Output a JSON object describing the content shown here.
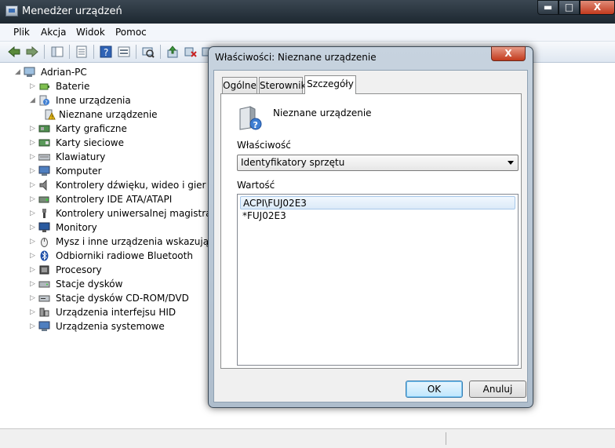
{
  "window": {
    "title": "Menedżer urządzeń",
    "controls": {
      "minimize": "▬",
      "maximize": "□",
      "close": "X"
    }
  },
  "menu": [
    "Plik",
    "Akcja",
    "Widok",
    "Pomoc"
  ],
  "toolbar_icons": [
    "back-arrow-icon",
    "forward-arrow-icon",
    "show-hide-tree-icon",
    "properties-icon",
    "help-icon",
    "view-icon",
    "scan-hardware-icon",
    "update-driver-icon",
    "uninstall-icon",
    "disable-icon"
  ],
  "tree": {
    "root": "Adrian-PC",
    "items": [
      {
        "label": "Baterie",
        "icon": "battery-icon",
        "expander": "▷"
      },
      {
        "label": "Inne urządzenia",
        "icon": "unknown-device-icon",
        "expander": "◢"
      },
      {
        "label": "Nieznane urządzenie",
        "icon": "warning-device-icon",
        "expander": ""
      },
      {
        "label": "Karty graficzne",
        "icon": "display-adapter-icon",
        "expander": "▷"
      },
      {
        "label": "Karty sieciowe",
        "icon": "network-adapter-icon",
        "expander": "▷"
      },
      {
        "label": "Klawiatury",
        "icon": "keyboard-icon",
        "expander": "▷"
      },
      {
        "label": "Komputer",
        "icon": "computer-icon",
        "expander": "▷"
      },
      {
        "label": "Kontrolery dźwięku, wideo i gier",
        "icon": "sound-icon",
        "expander": "▷"
      },
      {
        "label": "Kontrolery IDE ATA/ATAPI",
        "icon": "ide-controller-icon",
        "expander": "▷"
      },
      {
        "label": "Kontrolery uniwersalnej magistrali szeregowej",
        "icon": "usb-icon",
        "expander": "▷"
      },
      {
        "label": "Monitory",
        "icon": "monitor-icon",
        "expander": "▷"
      },
      {
        "label": "Mysz i inne urządzenia wskazujące",
        "icon": "mouse-icon",
        "expander": "▷"
      },
      {
        "label": "Odbiorniki radiowe Bluetooth",
        "icon": "bluetooth-icon",
        "expander": "▷"
      },
      {
        "label": "Procesory",
        "icon": "processor-icon",
        "expander": "▷"
      },
      {
        "label": "Stacje dysków",
        "icon": "disk-drive-icon",
        "expander": "▷"
      },
      {
        "label": "Stacje dysków CD-ROM/DVD",
        "icon": "cdrom-icon",
        "expander": "▷"
      },
      {
        "label": "Urządzenia interfejsu HID",
        "icon": "hid-icon",
        "expander": "▷"
      },
      {
        "label": "Urządzenia systemowe",
        "icon": "system-device-icon",
        "expander": "▷"
      }
    ]
  },
  "dialog": {
    "title": "Właściwości: Nieznane urządzenie",
    "close": "X",
    "tabs": [
      "Ogólne",
      "Sterownik",
      "Szczegóły"
    ],
    "active_tab": "Szczegóły",
    "device_name": "Nieznane urządzenie",
    "property_label": "Właściwość",
    "property_value": "Identyfikatory sprzętu",
    "value_label": "Wartość",
    "values": [
      "ACPI\\FUJ02E3",
      "*FUJ02E3"
    ],
    "ok": "OK",
    "cancel": "Anuluj"
  }
}
